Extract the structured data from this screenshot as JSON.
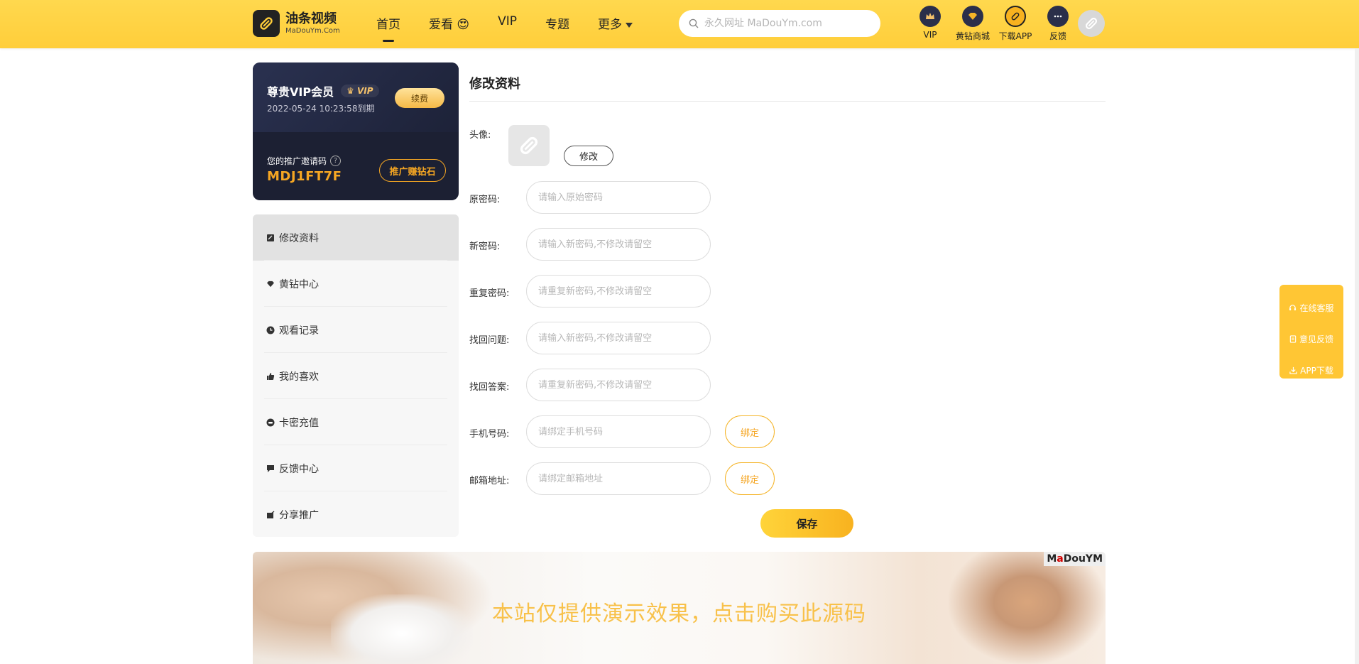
{
  "header": {
    "logo_name": "油条视频",
    "logo_sub": "MaDouYm.Com",
    "nav": [
      {
        "label": "首页"
      },
      {
        "label": "爱看 😍"
      },
      {
        "label": "VIP"
      },
      {
        "label": "专题"
      },
      {
        "label": "更多"
      }
    ],
    "search_placeholder": "永久网址 MaDouYm.com",
    "icons": [
      {
        "label": "VIP"
      },
      {
        "label": "黄钻商城"
      },
      {
        "label": "下载APP"
      },
      {
        "label": "反馈"
      }
    ]
  },
  "vip_card": {
    "title": "尊贵VIP会员",
    "badge": "VIP",
    "expire": "2022-05-24 10:23:58到期",
    "renew_label": "续费",
    "invite_label": "您的推广邀请码",
    "invite_code": "MDJ1FT7F",
    "promo_label": "推广赚钻石"
  },
  "menu": [
    {
      "label": "修改资料"
    },
    {
      "label": "黄钻中心"
    },
    {
      "label": "观看记录"
    },
    {
      "label": "我的喜欢"
    },
    {
      "label": "卡密充值"
    },
    {
      "label": "反馈中心"
    },
    {
      "label": "分享推广"
    }
  ],
  "form": {
    "title": "修改资料",
    "avatar_label": "头像:",
    "modify_label": "修改",
    "fields": [
      {
        "label": "原密码:",
        "placeholder": "请输入原始密码"
      },
      {
        "label": "新密码:",
        "placeholder": "请输入新密码,不修改请留空"
      },
      {
        "label": "重复密码:",
        "placeholder": "请重复新密码,不修改请留空"
      },
      {
        "label": "找回问题:",
        "placeholder": "请输入新密码,不修改请留空"
      },
      {
        "label": "找回答案:",
        "placeholder": "请重复新密码,不修改请留空"
      },
      {
        "label": "手机号码:",
        "placeholder": "请绑定手机号码"
      },
      {
        "label": "邮箱地址:",
        "placeholder": "请绑定邮箱地址"
      }
    ],
    "bind_label": "绑定",
    "save_label": "保存"
  },
  "banner": {
    "text": "本站仅提供演示效果，点击购买此源码",
    "watermark_prefix": "M",
    "watermark_r": "a",
    "watermark_suffix": "DouYM"
  },
  "float_menu": [
    {
      "label": "在线客服"
    },
    {
      "label": "意见反馈"
    },
    {
      "label": "APP下载"
    }
  ]
}
